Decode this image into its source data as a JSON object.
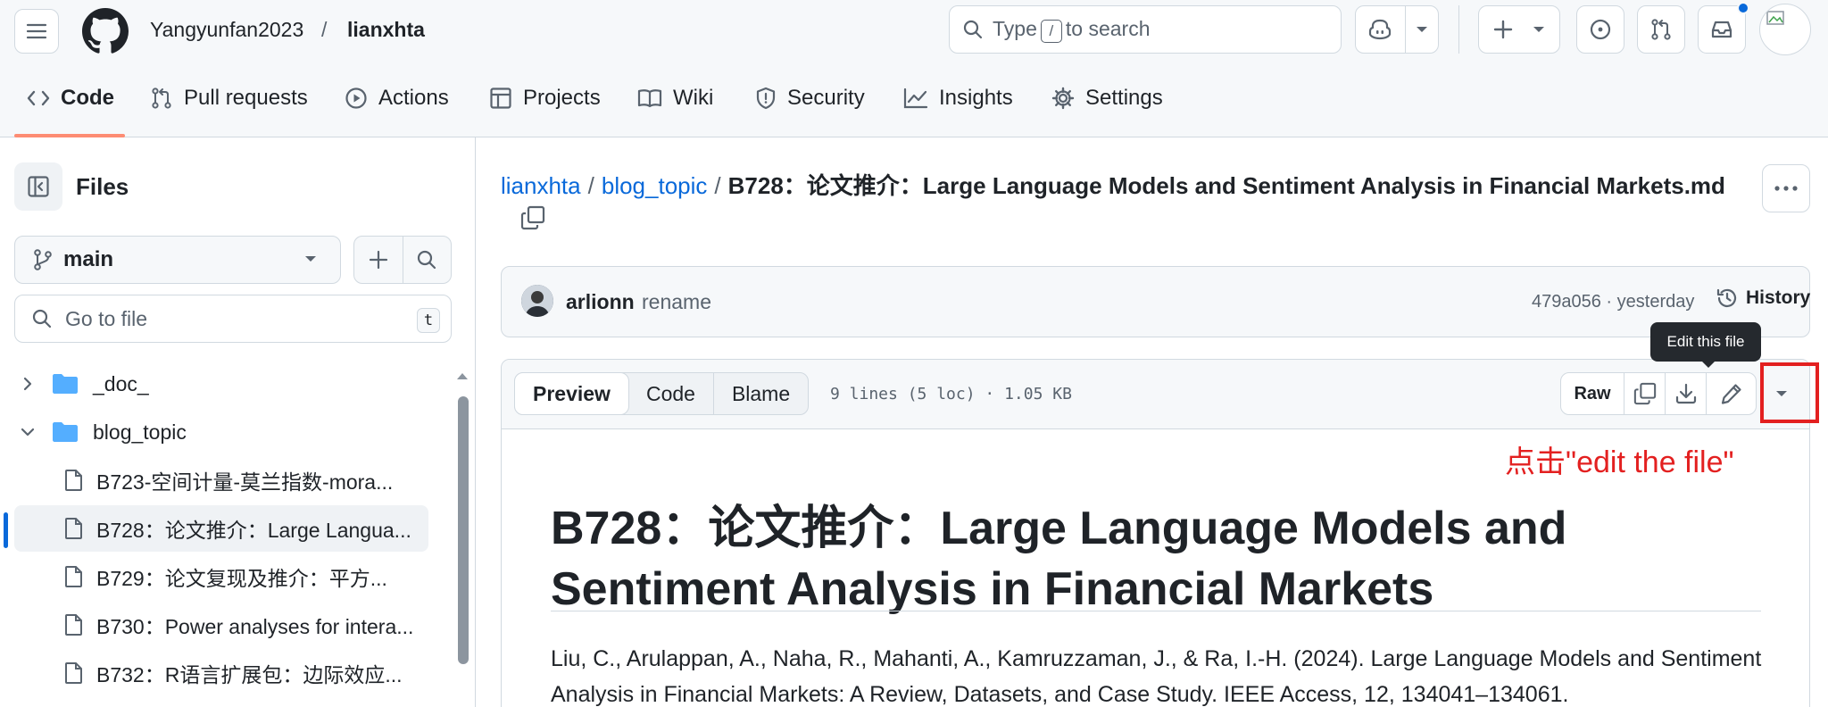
{
  "header": {
    "owner": "Yangyunfan2023",
    "separator": "/",
    "repo": "lianxhta",
    "search": {
      "prefix": "Type",
      "key": "/",
      "suffix": "to search"
    }
  },
  "repo_nav": {
    "items": [
      {
        "label": "Code",
        "icon": "code-icon"
      },
      {
        "label": "Pull requests",
        "icon": "pull-request-icon"
      },
      {
        "label": "Actions",
        "icon": "play-icon"
      },
      {
        "label": "Projects",
        "icon": "table-icon"
      },
      {
        "label": "Wiki",
        "icon": "book-icon"
      },
      {
        "label": "Security",
        "icon": "shield-icon"
      },
      {
        "label": "Insights",
        "icon": "graph-icon"
      },
      {
        "label": "Settings",
        "icon": "gear-icon"
      }
    ]
  },
  "sidebar": {
    "title": "Files",
    "branch": "main",
    "goto_placeholder": "Go to file",
    "goto_key": "t",
    "tree": [
      {
        "label": "_doc_",
        "type": "folder",
        "expanded": false
      },
      {
        "label": "blog_topic",
        "type": "folder",
        "expanded": true
      },
      {
        "label": "B723-空间计量-莫兰指数-mora...",
        "type": "file"
      },
      {
        "label": "B728：论文推介：Large Langua...",
        "type": "file",
        "selected": true
      },
      {
        "label": "B729：论文复现及推介：平方...",
        "type": "file"
      },
      {
        "label": "B730：Power analyses for intera...",
        "type": "file"
      },
      {
        "label": "B732：R语言扩展包：边际效应...",
        "type": "file"
      }
    ]
  },
  "main": {
    "path": {
      "repo": "lianxhta",
      "folder": "blog_topic",
      "sep": "/",
      "file": "B728：论文推介：Large Language Models and Sentiment Analysis in Financial Markets.md"
    },
    "commit": {
      "author": "arlionn",
      "message": "rename",
      "meta": "479a056 · yesterday",
      "history": "History"
    },
    "tooltip": "Edit this file",
    "file_header": {
      "tabs": [
        "Preview",
        "Code",
        "Blame"
      ],
      "active_tab": "Preview",
      "info": "9 lines (5 loc) · 1.05 KB",
      "raw": "Raw"
    },
    "annotation": "点击\"edit the file\"",
    "content": {
      "title": "B728：论文推介：Large Language Models and Sentiment Analysis in Financial Markets",
      "citation": "Liu, C., Arulappan, A., Naha, R., Mahanti, A., Kamruzzaman, J., & Ra, I.-H. (2024). Large Language Models and Sentiment Analysis in Financial Markets: A Review, Datasets, and Case Study. IEEE Access, 12, 134041–134061."
    }
  },
  "colors": {
    "accent": "#0969da",
    "nav_underline": "#fd8c73",
    "annotation": "#e32020",
    "folder": "#54aeff"
  }
}
